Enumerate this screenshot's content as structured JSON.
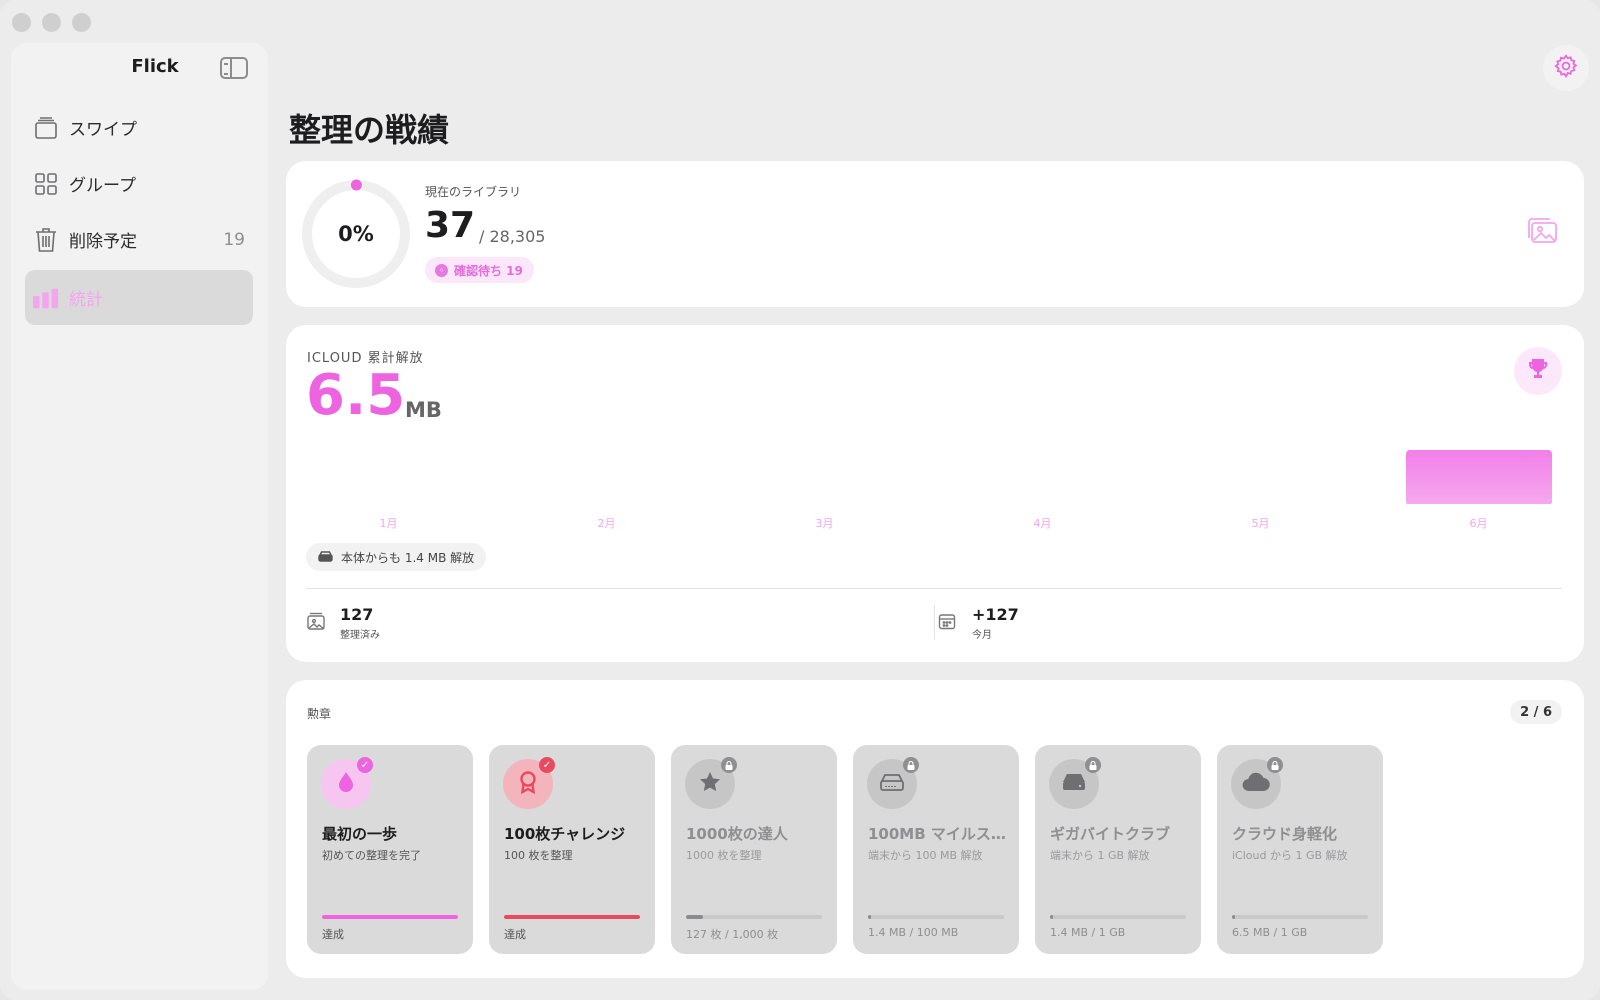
{
  "app": {
    "title": "Flick"
  },
  "sidebar": {
    "items": [
      {
        "label": "スワイプ",
        "icon": "cards-icon"
      },
      {
        "label": "グループ",
        "icon": "grid-icon"
      },
      {
        "label": "削除予定",
        "icon": "trash-icon",
        "badge": "19"
      },
      {
        "label": "統計",
        "icon": "bar-chart-icon"
      }
    ],
    "active_index": 3
  },
  "colors": {
    "accent": "#ee63df",
    "accent_light": "#f3a6ee",
    "red": "#e84a5f"
  },
  "page": {
    "title": "整理の戦績"
  },
  "library": {
    "percent_label": "0%",
    "percent": 0.0013,
    "caption": "現在のライブラリ",
    "count": "37",
    "total": "/ 28,305",
    "pending_label": "確認待ち 19"
  },
  "icloud": {
    "caption": "ICLOUD 累計解放",
    "value": "6.5",
    "unit": "MB",
    "device_chip": "本体からも 1.4 MB 解放",
    "stats": [
      {
        "value": "127",
        "caption": "整理済み"
      },
      {
        "value": "+127",
        "caption": "今月"
      }
    ]
  },
  "chart_data": {
    "type": "bar",
    "categories": [
      "1月",
      "2月",
      "3月",
      "4月",
      "5月",
      "6月"
    ],
    "values": [
      0,
      0,
      0,
      0,
      0,
      6.5
    ],
    "ylabel": "",
    "xlabel": ""
  },
  "badges": {
    "title": "勲章",
    "count": "2 / 6",
    "items": [
      {
        "name": "最初の一歩",
        "desc": "初めての整理を完了",
        "status": "達成",
        "progress": 1.0,
        "achieved": true,
        "icon": "drop-icon",
        "color": "#ee63df"
      },
      {
        "name": "100枚チャレンジ",
        "desc": "100 枚を整理",
        "status": "達成",
        "progress": 1.0,
        "achieved": true,
        "icon": "ribbon-icon",
        "color": "#e84a5f"
      },
      {
        "name": "1000枚の達人",
        "desc": "1000 枚を整理",
        "status": "127 枚 / 1,000 枚",
        "progress": 0.127,
        "achieved": false,
        "icon": "star-icon",
        "color": "#8e8e93"
      },
      {
        "name": "100MB マイルス…",
        "desc": "端末から 100 MB 解放",
        "status": "1.4 MB / 100 MB",
        "progress": 0.014,
        "achieved": false,
        "icon": "drive-icon",
        "color": "#8e8e93"
      },
      {
        "name": "ギガバイトクラブ",
        "desc": "端末から 1 GB 解放",
        "status": "1.4 MB / 1 GB",
        "progress": 0.0014,
        "achieved": false,
        "icon": "harddisk-icon",
        "color": "#8e8e93"
      },
      {
        "name": "クラウド身軽化",
        "desc": "iCloud から 1 GB 解放",
        "status": "6.5 MB / 1 GB",
        "progress": 0.0065,
        "achieved": false,
        "icon": "cloud-icon",
        "color": "#8e8e93"
      }
    ]
  }
}
